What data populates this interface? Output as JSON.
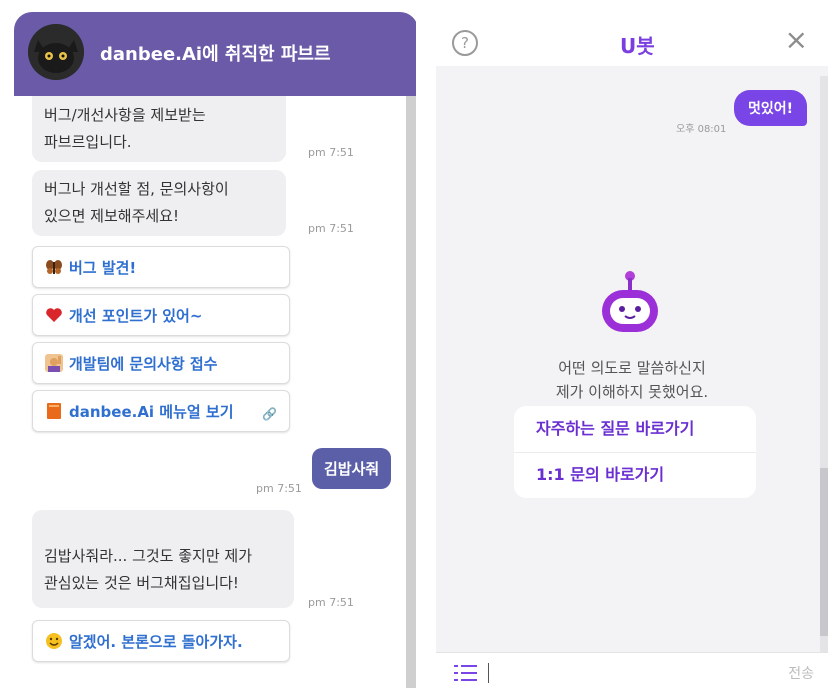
{
  "left": {
    "title": "danbee.Ai에 취직한 파브르",
    "messages": [
      {
        "text": "버그/개선사항을 제보받는\n파브르입니다.",
        "time": "pm 7:51"
      },
      {
        "text": "버그나 개선할 점, 문의사항이\n있으면 제보해주세요!",
        "time": "pm 7:51"
      }
    ],
    "quick_replies": [
      {
        "label": "버그 발견!",
        "icon": "butterfly-icon"
      },
      {
        "label": "개선 포인트가 있어~",
        "icon": "heart-icon"
      },
      {
        "label": "개발팀에 문의사항 접수",
        "icon": "person-raising-hand-icon"
      },
      {
        "label": "danbee.Ai 메뉴얼 보기",
        "icon": "book-icon"
      }
    ],
    "link_glyph": "🔗",
    "user_message": {
      "text": "김밥사줘",
      "time": "pm 7:51"
    },
    "reply": {
      "text": "김밥사줘라... 그것도 좋지만 제가\n관심있는 것은 버그채집입니다!",
      "glyph": "✾",
      "time": "pm 7:51"
    },
    "final_reply": {
      "label": "알겠어. 본론으로 돌아가자.",
      "icon": "smile-icon"
    }
  },
  "right": {
    "title": "U봇",
    "help_glyph": "?",
    "close_glyph": "×",
    "user_message": {
      "text": "멋있어!",
      "time": "오후 08:01"
    },
    "fallback": "어떤 의도로 말씀하신지\n제가 이해하지 못했어요.",
    "choices": [
      "자주하는 질문 바로가기",
      "1:1 문의 바로가기"
    ],
    "send_label": "전송",
    "colors": {
      "accent": "#7a45e6",
      "header": "#6a5aa8"
    }
  }
}
